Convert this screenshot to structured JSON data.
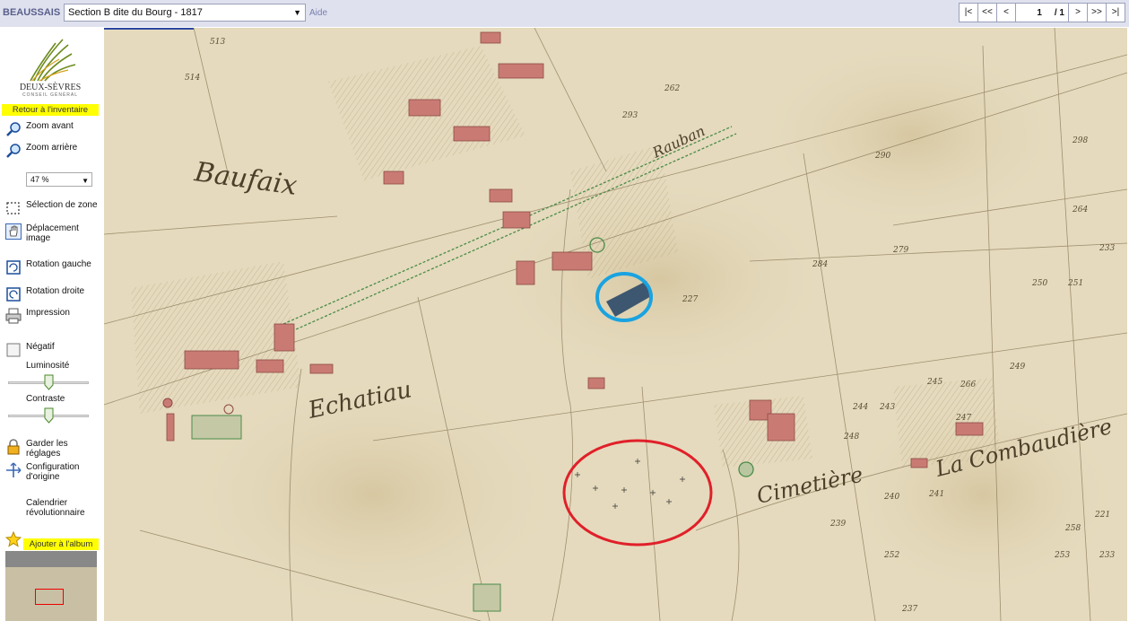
{
  "header": {
    "title": "BEAUSSAIS",
    "document_select": "Section B dite du Bourg - 1817",
    "help": "Aide",
    "pager": {
      "first": "|<",
      "prev_fast": "<<",
      "prev": "<",
      "page": "1",
      "total": "/ 1",
      "next": ">",
      "next_fast": ">>",
      "last": ">|"
    }
  },
  "sidebar": {
    "logo_name": "DEUX-SÈVRES",
    "logo_sub": "CONSEIL GÉNÉRAL",
    "back_link": "Retour à l'inventaire",
    "zoom_in": "Zoom avant",
    "zoom_out": "Zoom arrière",
    "zoom_value": "47 %",
    "select_zone": "Sélection de zone",
    "move_image": "Déplacement image",
    "rotate_left": "Rotation gauche",
    "rotate_right": "Rotation droite",
    "print": "Impression",
    "negative": "Négatif",
    "brightness": "Luminosité",
    "contrast": "Contraste",
    "keep_settings": "Garder les réglages",
    "origin_config": "Configuration d'origine",
    "calendar": "Calendrier révolutionnaire",
    "add_album": "Ajouter à l'album",
    "brightness_level": 0.5,
    "contrast_level": 0.5
  },
  "map": {
    "labels": [
      "Baufaix",
      "Echatiau",
      "Rauban",
      "Cimetière",
      "La Combaudière"
    ],
    "parcel_numbers": [
      "513",
      "514",
      "293",
      "262",
      "298",
      "290",
      "264",
      "233",
      "279",
      "250",
      "251",
      "284",
      "227",
      "249",
      "266",
      "245",
      "243",
      "244",
      "241",
      "240",
      "221",
      "239",
      "237",
      "252",
      "253",
      "258",
      "233",
      "247",
      "248"
    ],
    "highlight_colors": {
      "blue": "#1aa3e0",
      "red": "#e0202a"
    }
  }
}
